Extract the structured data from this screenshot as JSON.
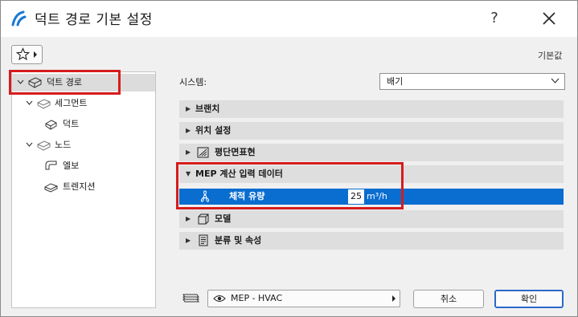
{
  "window": {
    "title": "덕트 경로 기본 설정",
    "help_label": "?",
    "defaults_label": "기본값"
  },
  "tree": {
    "items": [
      {
        "label": "덕트 경로",
        "icon": "duct-route-icon",
        "expanded": true,
        "selected": true
      },
      {
        "label": "세그먼트",
        "icon": "segment-icon",
        "expanded": true
      },
      {
        "label": "덕트",
        "icon": "duct-icon"
      },
      {
        "label": "노드",
        "icon": "node-icon",
        "expanded": true
      },
      {
        "label": "엘보",
        "icon": "elbow-icon"
      },
      {
        "label": "트렌지션",
        "icon": "transition-icon"
      }
    ]
  },
  "system": {
    "label": "시스템:",
    "value": "배기"
  },
  "sections": [
    {
      "label": "브랜치",
      "expanded": false
    },
    {
      "label": "위치 설정",
      "expanded": false
    },
    {
      "label": "평단면표현",
      "expanded": false,
      "icon": "floor-plan-icon"
    },
    {
      "label": "MEP 계산 입력 데이터",
      "expanded": true
    },
    {
      "label": "모델",
      "expanded": false,
      "icon": "model-cube-icon"
    },
    {
      "label": "분류 및 속성",
      "expanded": false,
      "icon": "document-icon"
    }
  ],
  "param": {
    "label": "체적 유량",
    "value": "25",
    "unit": "m³/h",
    "icon": "fan-icon"
  },
  "footer": {
    "layer_value": "MEP - HVAC",
    "cancel_label": "취소",
    "ok_label": "확인"
  },
  "colors": {
    "accent": "#0a6dd0",
    "highlight_box": "#d61c1c"
  }
}
